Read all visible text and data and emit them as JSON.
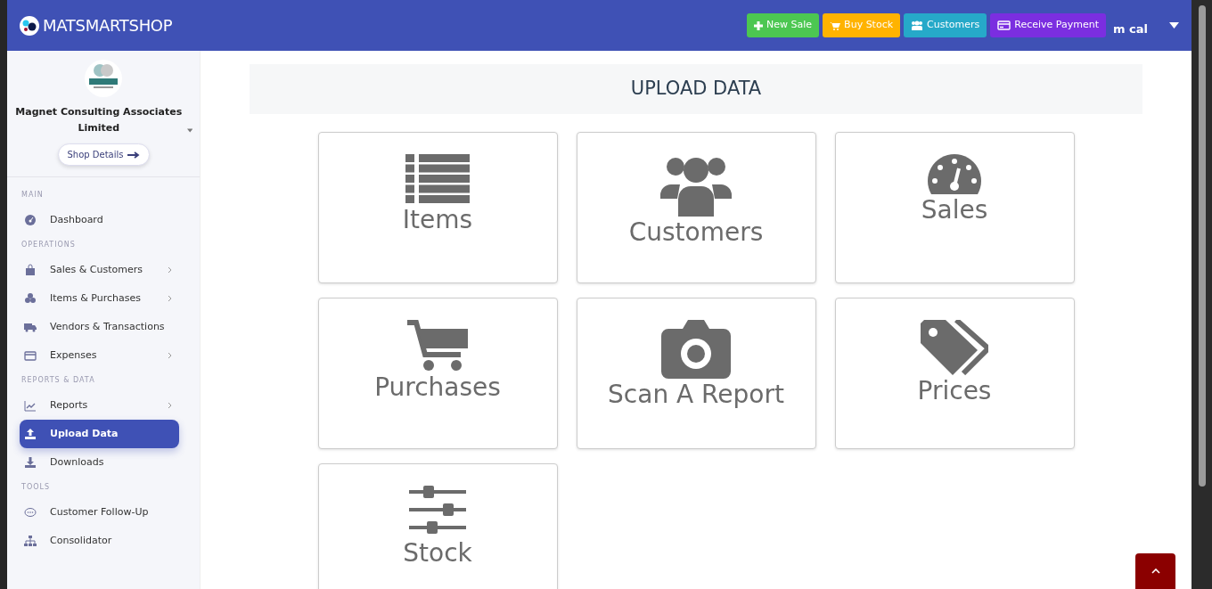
{
  "brand": {
    "name": "MATSMARTSHOP"
  },
  "header_buttons": [
    {
      "label": "New Sale",
      "color": "#4cc751"
    },
    {
      "label": "Buy Stock",
      "color": "#ffb300"
    },
    {
      "label": "Customers",
      "color": "#26a9c9"
    },
    {
      "label": "Receive Payment",
      "color": "#7b2ee0"
    }
  ],
  "user": {
    "name": "m cal"
  },
  "shop": {
    "name": "Magnet Consulting Associates Limited",
    "details_button": "Shop Details"
  },
  "sidebar": {
    "sections": [
      {
        "title": "MAIN",
        "items": [
          {
            "label": "Dashboard",
            "submenu": false,
            "selected": false
          }
        ]
      },
      {
        "title": "OPERATIONS",
        "items": [
          {
            "label": "Sales & Customers",
            "submenu": true,
            "selected": false
          },
          {
            "label": "Items & Purchases",
            "submenu": true,
            "selected": false
          },
          {
            "label": "Vendors & Transactions",
            "submenu": false,
            "selected": false
          },
          {
            "label": "Expenses",
            "submenu": true,
            "selected": false
          }
        ]
      },
      {
        "title": "REPORTS & DATA",
        "items": [
          {
            "label": "Reports",
            "submenu": true,
            "selected": false
          },
          {
            "label": "Upload Data",
            "submenu": false,
            "selected": true
          },
          {
            "label": "Downloads",
            "submenu": false,
            "selected": false
          }
        ]
      },
      {
        "title": "TOOLS",
        "items": [
          {
            "label": "Customer Follow-Up",
            "submenu": false,
            "selected": false
          },
          {
            "label": "Consolidator",
            "submenu": false,
            "selected": false
          }
        ]
      }
    ]
  },
  "page": {
    "title": "UPLOAD DATA"
  },
  "tiles": [
    {
      "label": "Items"
    },
    {
      "label": "Customers"
    },
    {
      "label": "Sales"
    },
    {
      "label": "Purchases"
    },
    {
      "label": "Scan A Report"
    },
    {
      "label": "Prices"
    },
    {
      "label": "Stock"
    }
  ]
}
